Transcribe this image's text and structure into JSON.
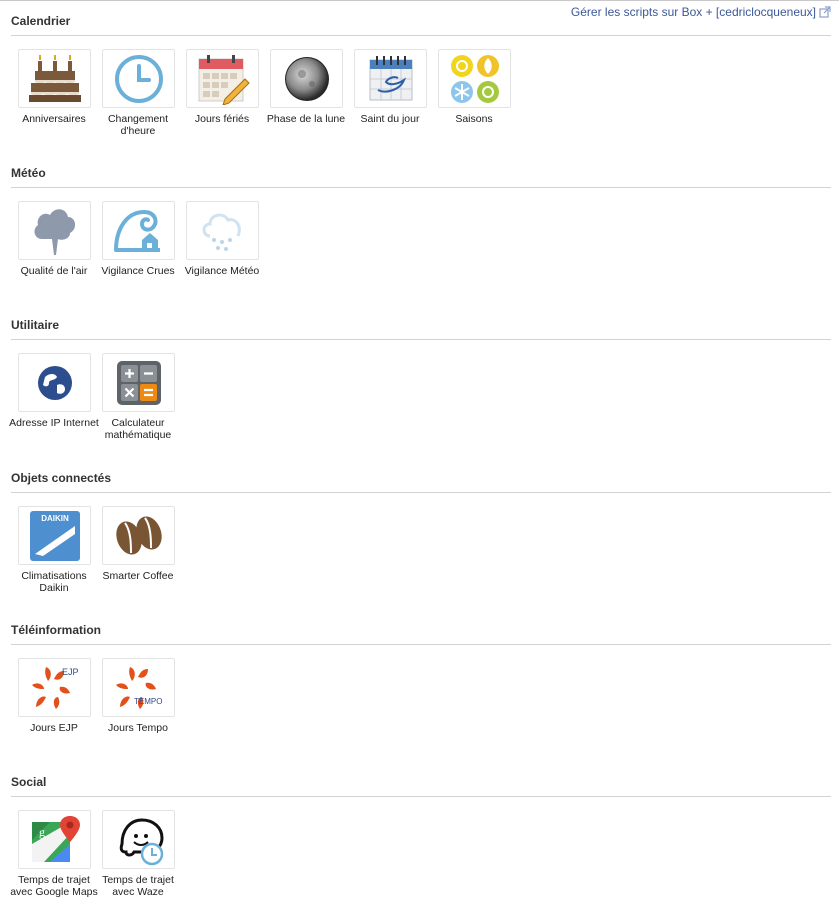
{
  "header": {
    "manage_link": "Gérer les scripts sur Box + [cedriclocqueneux]"
  },
  "sections": {
    "calendrier": {
      "title": "Calendrier",
      "items": [
        "Anniversaires",
        "Changement d'heure",
        "Jours fériés",
        "Phase de la lune",
        "Saint du jour",
        "Saisons"
      ]
    },
    "meteo": {
      "title": "Météo",
      "items": [
        "Qualité de l'air",
        "Vigilance Crues",
        "Vigilance Météo"
      ]
    },
    "utilitaire": {
      "title": "Utilitaire",
      "items": [
        "Adresse IP Internet",
        "Calculateur mathématique"
      ]
    },
    "objets": {
      "title": "Objets connectés",
      "items": [
        "Climatisations Daikin",
        "Smarter Coffee"
      ]
    },
    "teleinfo": {
      "title": "Téléinformation",
      "items": [
        "Jours EJP",
        "Jours Tempo"
      ]
    },
    "social": {
      "title": "Social",
      "items": [
        "Temps de trajet avec Google Maps",
        "Temps de trajet avec Waze"
      ]
    }
  },
  "icon_text": {
    "daikin": "DAIKIN",
    "ejp": "EJP",
    "tempo": "TEMPO",
    "google_g": "g"
  },
  "colors": {
    "link": "#3b5998",
    "rule": "#d3d3d3",
    "edf_orange": "#e2501c",
    "daikin_blue": "#4d8fcf"
  }
}
